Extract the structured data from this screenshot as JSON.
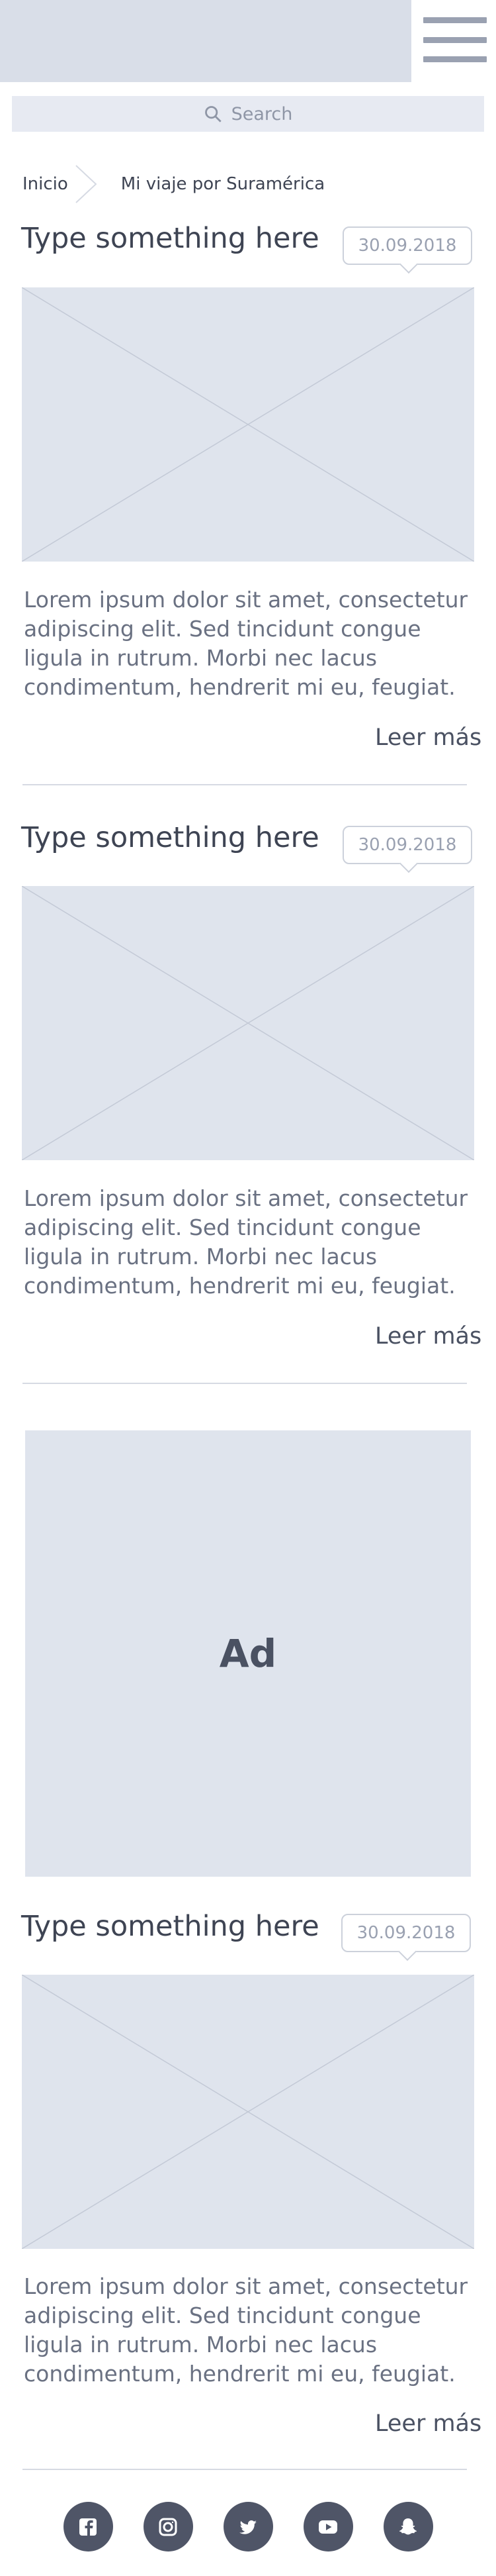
{
  "header": {
    "logo_icon": "logo-placeholder",
    "menu_icon": "hamburger-menu-icon"
  },
  "search": {
    "placeholder": "Search",
    "icon": "search-icon"
  },
  "breadcrumb": {
    "items": [
      "Inicio",
      "Mi viaje por Suramérica"
    ]
  },
  "posts": [
    {
      "title": "Type something here",
      "date": "30.09.2018",
      "excerpt": "Lorem ipsum dolor sit amet, consectetur adipiscing elit. Sed tincidunt congue ligula in rutrum. Morbi nec lacus condimentum, hendrerit mi eu, feugiat.",
      "read_more": "Leer más"
    },
    {
      "title": "Type something here",
      "date": "30.09.2018",
      "excerpt": "Lorem ipsum dolor sit amet, consectetur adipiscing elit. Sed tincidunt congue ligula in rutrum. Morbi nec lacus condimentum, hendrerit mi eu, feugiat.",
      "read_more": "Leer más"
    },
    {
      "title": "Type something here",
      "date": "30.09.2018",
      "excerpt": "Lorem ipsum dolor sit amet, consectetur adipiscing elit. Sed tincidunt congue ligula in rutrum. Morbi nec lacus condimentum, hendrerit mi eu, feugiat.",
      "read_more": "Leer más"
    }
  ],
  "ad": {
    "label": "Ad"
  },
  "social": [
    "facebook-icon",
    "instagram-icon",
    "twitter-icon",
    "youtube-icon",
    "snapchat-icon"
  ],
  "colors": {
    "placeholder": "#dfe4ed",
    "icon_dark": "#4f5567",
    "text": "#4a5162"
  }
}
